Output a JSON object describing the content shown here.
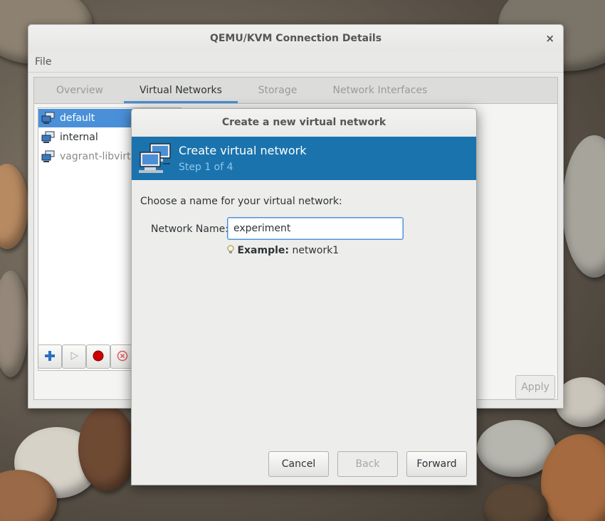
{
  "main_window": {
    "title": "QEMU/KVM Connection Details",
    "close_glyph": "×",
    "menu": {
      "file": "File"
    },
    "tabs": [
      {
        "label": "Overview",
        "active": false
      },
      {
        "label": "Virtual Networks",
        "active": true
      },
      {
        "label": "Storage",
        "active": false
      },
      {
        "label": "Network Interfaces",
        "active": false
      }
    ],
    "networks": [
      {
        "name": "default",
        "selected": true,
        "icon": "network-icon"
      },
      {
        "name": "internal",
        "selected": false,
        "icon": "network-icon"
      },
      {
        "name": "vagrant-libvirt",
        "selected": false,
        "icon": "network-icon"
      }
    ],
    "toolbar": {
      "add_icon": "plus-icon",
      "start_icon": "play-icon",
      "stop_icon": "stop-record-icon",
      "delete_icon": "delete-circle-icon"
    },
    "apply_label": "Apply"
  },
  "dialog": {
    "title": "Create a new virtual network",
    "header_title": "Create virtual network",
    "header_step": "Step 1 of 4",
    "prompt": "Choose a name for your virtual network:",
    "name_label": "Network Name:",
    "name_value": "experiment",
    "example_label": "Example:",
    "example_value": "network1",
    "buttons": {
      "cancel": "Cancel",
      "back": "Back",
      "forward": "Forward"
    }
  },
  "colors": {
    "accent": "#4a90d9",
    "dialog_header_bg": "#1a73ad",
    "dialog_step_text": "#8fc6ee",
    "record_red": "#cc0000"
  }
}
